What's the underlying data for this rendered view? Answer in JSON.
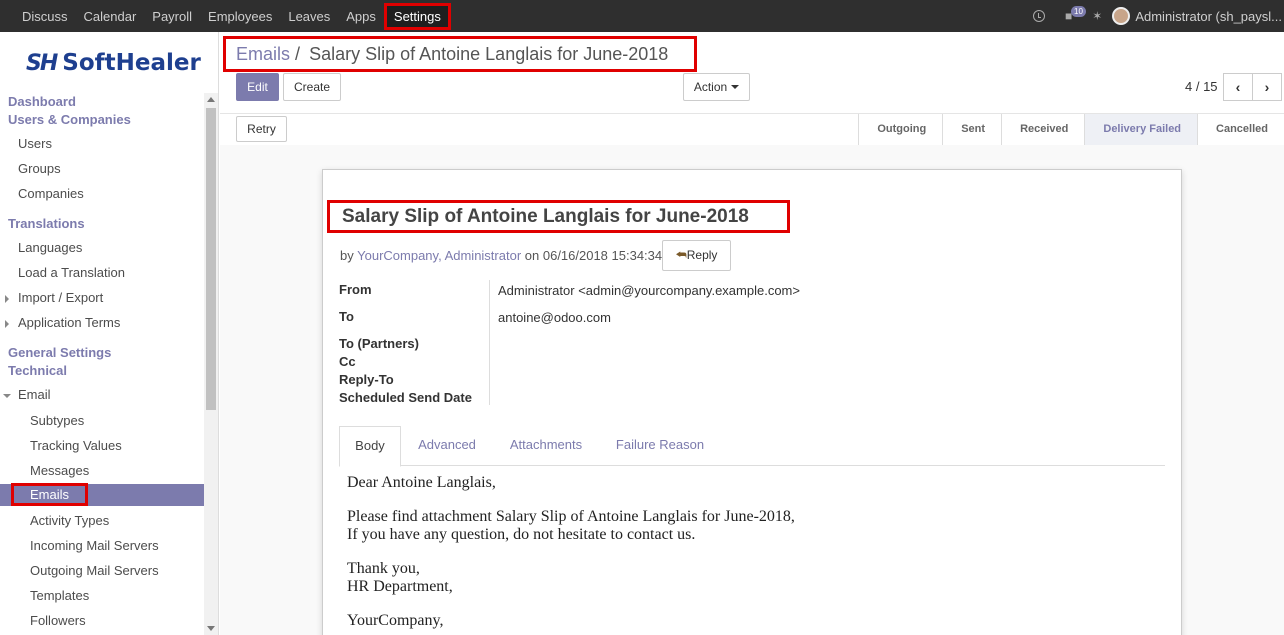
{
  "topbar": {
    "menu": [
      "Discuss",
      "Calendar",
      "Payroll",
      "Employees",
      "Leaves",
      "Apps",
      "Settings"
    ],
    "chat_count": "10",
    "user": "Administrator (sh_paysl..."
  },
  "logo": {
    "mark": "SH",
    "word": "SoftHealer"
  },
  "sidebar": {
    "items": [
      {
        "label": "Dashboard",
        "kind": "head"
      },
      {
        "label": "Users & Companies",
        "kind": "head"
      },
      {
        "label": "Users",
        "kind": "l1"
      },
      {
        "label": "Groups",
        "kind": "l1"
      },
      {
        "label": "Companies",
        "kind": "l1"
      },
      {
        "label": "Translations",
        "kind": "head"
      },
      {
        "label": "Languages",
        "kind": "l1"
      },
      {
        "label": "Load a Translation",
        "kind": "l1"
      },
      {
        "label": "Import / Export",
        "kind": "l1"
      },
      {
        "label": "Application Terms",
        "kind": "l1"
      },
      {
        "label": "General Settings",
        "kind": "head"
      },
      {
        "label": "Technical",
        "kind": "head"
      },
      {
        "label": "Email",
        "kind": "l1"
      },
      {
        "label": "Subtypes",
        "kind": "l2"
      },
      {
        "label": "Tracking Values",
        "kind": "l2"
      },
      {
        "label": "Messages",
        "kind": "l2"
      },
      {
        "label": "Emails",
        "kind": "l2"
      },
      {
        "label": "Activity Types",
        "kind": "l2"
      },
      {
        "label": "Incoming Mail Servers",
        "kind": "l2"
      },
      {
        "label": "Outgoing Mail Servers",
        "kind": "l2"
      },
      {
        "label": "Templates",
        "kind": "l2"
      },
      {
        "label": "Followers",
        "kind": "l2"
      }
    ]
  },
  "breadcrumb": {
    "parent": "Emails",
    "separator": "/",
    "current": "Salary Slip of Antoine Langlais for June-2018"
  },
  "buttons": {
    "edit": "Edit",
    "create": "Create",
    "action": "Action",
    "retry": "Retry",
    "reply": "Reply"
  },
  "pager": {
    "value": "4 / 15"
  },
  "stages": [
    "Outgoing",
    "Sent",
    "Received",
    "Delivery Failed",
    "Cancelled"
  ],
  "current_stage": "Delivery Failed",
  "email": {
    "subject": "Salary Slip of Antoine Langlais for June-2018",
    "by_prefix": "by",
    "author": "YourCompany, Administrator",
    "date_text": "on 06/16/2018 15:34:34",
    "fields": [
      {
        "label": "From",
        "value": "Administrator <admin@yourcompany.example.com>"
      },
      {
        "label": "To",
        "value": "antoine@odoo.com"
      },
      {
        "label": "To (Partners)",
        "value": ""
      },
      {
        "label": "Cc",
        "value": ""
      },
      {
        "label": "Reply-To",
        "value": ""
      },
      {
        "label": "Scheduled Send Date",
        "value": ""
      }
    ],
    "tabs": [
      "Body",
      "Advanced",
      "Attachments",
      "Failure Reason"
    ],
    "body": {
      "greeting": "Dear Antoine Langlais,",
      "line1": "Please find attachment Salary Slip of Antoine Langlais for June-2018,",
      "line2": "If you have any question, do not hesitate to contact us.",
      "thanks": "Thank you,",
      "dept": "HR Department,",
      "company": "YourCompany,"
    }
  },
  "colors": {
    "accent": "#7c7bad",
    "highlight": "#e00000",
    "topbar": "#2f2f2f"
  }
}
